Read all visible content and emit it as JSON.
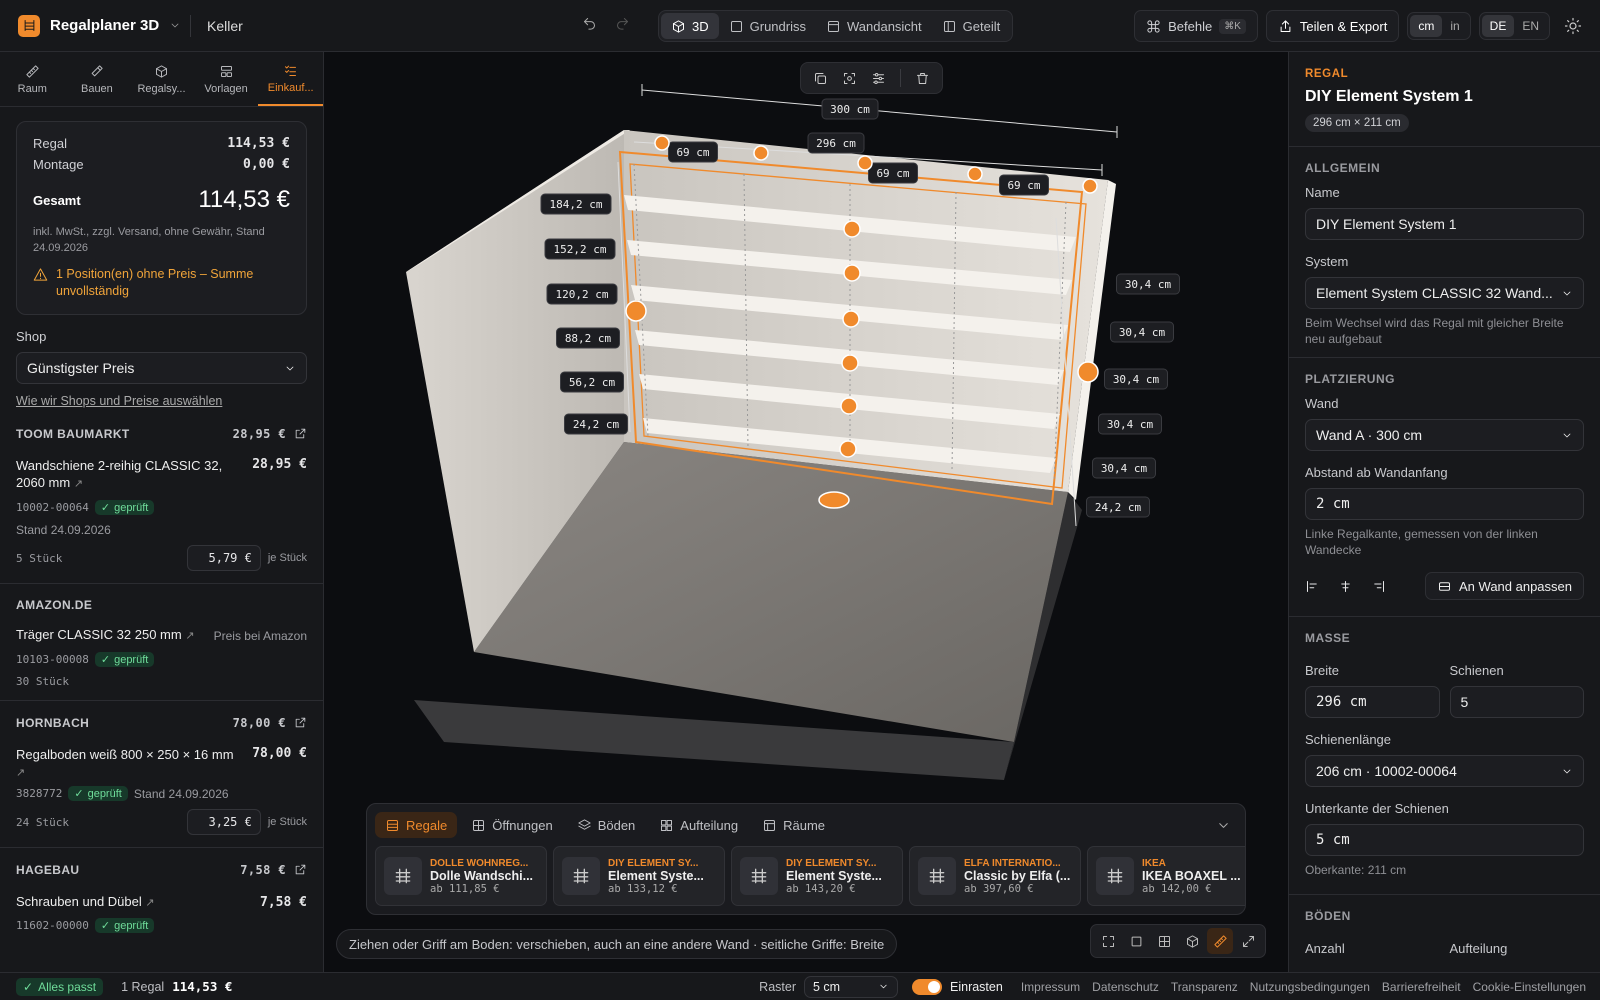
{
  "app": {
    "name": "Regalplaner 3D",
    "project": "Keller"
  },
  "views": [
    {
      "label": "3D"
    },
    {
      "label": "Grundriss"
    },
    {
      "label": "Wandansicht"
    },
    {
      "label": "Geteilt"
    }
  ],
  "header": {
    "commands": "Befehle",
    "shortcut": "⌘K",
    "share": "Teilen & Export",
    "unit_cm": "cm",
    "unit_in": "in",
    "lang_de": "DE",
    "lang_en": "EN"
  },
  "left_tabs": [
    {
      "label": "Raum"
    },
    {
      "label": "Bauen"
    },
    {
      "label": "Regalsy..."
    },
    {
      "label": "Vorlagen"
    },
    {
      "label": "Einkauf..."
    }
  ],
  "summary": {
    "regal_label": "Regal",
    "regal_value": "114,53 €",
    "montage_label": "Montage",
    "montage_value": "0,00 €",
    "total_label": "Gesamt",
    "total_value": "114,53 €",
    "note": "inkl. MwSt., zzgl. Versand, ohne Gewähr, Stand 24.09.2026",
    "warning": "1 Position(en) ohne Preis – Summe unvollständig"
  },
  "shop": {
    "label": "Shop",
    "selected": "Günstigster Preis",
    "link": "Wie wir Shops und Preise auswählen"
  },
  "shops": [
    {
      "name": "TOOM BAUMARKT",
      "total": "28,95 €",
      "item": "Wandschiene 2-reihig CLASSIC 32, 2060 mm",
      "item_price": "28,95 €",
      "sku": "10002-00064",
      "badge": "geprüft",
      "stand": "Stand 24.09.2026",
      "qty": "5 Stück",
      "unit_price": "5,79 €",
      "per": "je Stück"
    },
    {
      "name": "AMAZON.DE",
      "total": "",
      "item": "Träger CLASSIC 32 250 mm",
      "item_price": "Preis bei Amazon",
      "sku": "10103-00008",
      "badge": "geprüft",
      "qty": "30 Stück"
    },
    {
      "name": "HORNBACH",
      "total": "78,00 €",
      "item": "Regalboden weiß 800 × 250 × 16 mm",
      "item_price": "78,00 €",
      "sku": "3828772",
      "badge": "geprüft",
      "stand": "Stand 24.09.2026",
      "qty": "24 Stück",
      "unit_price": "3,25 €",
      "per": "je Stück"
    },
    {
      "name": "HAGEBAU",
      "total": "7,58 €",
      "item": "Schrauben und Dübel",
      "item_price": "7,58 €",
      "sku": "11602-00000",
      "badge": "geprüft"
    }
  ],
  "scene": {
    "dims_top": {
      "outer": "300 cm",
      "inner": "296 cm",
      "bays": [
        "69 cm",
        "69 cm",
        "69 cm"
      ]
    },
    "heights": [
      "184,2 cm",
      "152,2 cm",
      "120,2 cm",
      "88,2 cm",
      "56,2 cm",
      "24,2 cm"
    ],
    "spacings": [
      "30,4 cm",
      "30,4 cm",
      "30,4 cm",
      "30,4 cm",
      "30,4 cm",
      "24,2 cm"
    ]
  },
  "bottom_panel": {
    "tabs": [
      {
        "label": "Regale"
      },
      {
        "label": "Öffnungen"
      },
      {
        "label": "Böden"
      },
      {
        "label": "Aufteilung"
      },
      {
        "label": "Räume"
      }
    ],
    "cards": [
      {
        "brand": "DOLLE WOHNREG...",
        "name": "Dolle Wandschi...",
        "price": "ab 111,85 €"
      },
      {
        "brand": "DIY ELEMENT SY...",
        "name": "Element Syste...",
        "price": "ab 133,12 €"
      },
      {
        "brand": "DIY ELEMENT SY...",
        "name": "Element Syste...",
        "price": "ab 143,20 €"
      },
      {
        "brand": "ELFA INTERNATIO...",
        "name": "Classic by Elfa (...",
        "price": "ab 397,60 €"
      },
      {
        "brand": "IKEA",
        "name": "IKEA BOAXEL ...",
        "price": "ab 142,00 €"
      }
    ]
  },
  "hint": "Ziehen oder Griff am Boden: verschieben, auch an eine andere Wand · seitliche Griffe: Breite",
  "inspector": {
    "kind": "REGAL",
    "title": "DIY Element System 1",
    "size": "296 cm × 211 cm",
    "general": {
      "section": "ALLGEMEIN",
      "name_label": "Name",
      "name_value": "DIY Element System 1",
      "system_label": "System",
      "system_value": "Element System CLASSIC 32 Wand...",
      "system_help": "Beim Wechsel wird das Regal mit gleicher Breite neu aufgebaut"
    },
    "placement": {
      "section": "PLATZIERUNG",
      "wall_label": "Wand",
      "wall_value": "Wand A · 300 cm",
      "offset_label": "Abstand ab Wandanfang",
      "offset_value": "2 cm",
      "offset_help": "Linke Regalkante, gemessen von der linken Wandecke",
      "fit_button": "An Wand anpassen"
    },
    "masse": {
      "section": "MASSE",
      "width_label": "Breite",
      "width_value": "296 cm",
      "rails_label": "Schienen",
      "rails_value": "5",
      "rail_len_label": "Schienenlänge",
      "rail_len_value": "206 cm · 10002-00064",
      "bottom_label": "Unterkante der Schienen",
      "bottom_value": "5 cm",
      "top_note": "Oberkante: 211 cm"
    },
    "boden": {
      "section": "BÖDEN",
      "count_label": "Anzahl",
      "split_label": "Aufteilung"
    }
  },
  "status": {
    "ok": "Alles passt",
    "count": "1 Regal",
    "total": "114,53 €",
    "grid_label": "Raster",
    "grid_value": "5 cm",
    "snap": "Einrasten",
    "links": [
      {
        "label": "Impressum"
      },
      {
        "label": "Datenschutz"
      },
      {
        "label": "Transparenz"
      },
      {
        "label": "Nutzungsbedingungen"
      },
      {
        "label": "Barrierefreiheit"
      },
      {
        "label": "Cookie-Einstellungen"
      }
    ]
  },
  "colors": {
    "accent": "#f08a2c",
    "ok": "#6fdc9a",
    "bg": "#121316"
  }
}
